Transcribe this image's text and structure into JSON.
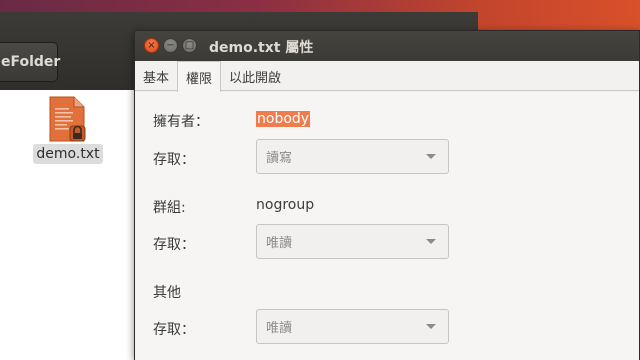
{
  "background_window": {
    "folder_button_label": "eFolder",
    "file": {
      "name": "demo.txt",
      "icon": "text-file-locked-icon"
    }
  },
  "dialog": {
    "title": "demo.txt 屬性",
    "window_buttons": {
      "close": "×",
      "minimize": "−",
      "maximize": "□"
    },
    "tabs": [
      {
        "label": "基本",
        "active": false
      },
      {
        "label": "權限",
        "active": true
      },
      {
        "label": "以此開啟",
        "active": false
      }
    ],
    "owner": {
      "label": "擁有者：",
      "value": "nobody",
      "access_label": "存取：",
      "access_value": "讀寫"
    },
    "group": {
      "label": "群組:",
      "value": "nogroup",
      "access_label": "存取：",
      "access_value": "唯讀"
    },
    "others": {
      "label": "其他",
      "access_label": "存取：",
      "access_value": "唯讀"
    }
  },
  "colors": {
    "selection": "#ee7c4c",
    "titlebar": "#3b3a36",
    "close_button": "#df4a16",
    "file_icon": "#e2703a"
  }
}
